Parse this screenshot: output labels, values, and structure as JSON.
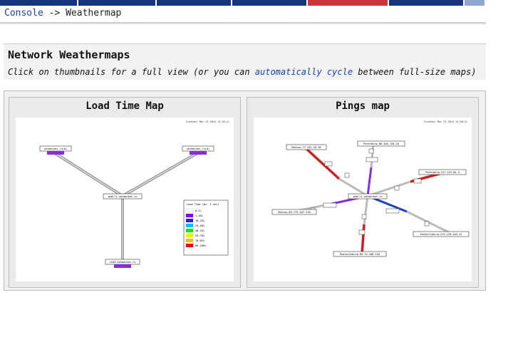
{
  "breadcrumb": {
    "console": "Console",
    "sep": " -> ",
    "current": "Weathermap"
  },
  "section": {
    "title": "Network Weathermaps",
    "sub_before": "Click on thumbnails for a full view (or you can ",
    "sub_link": "automatically cycle",
    "sub_after": " between full-size maps)"
  },
  "maps": [
    {
      "title": "Load Time Map",
      "created": "Created: Mar 23 2014 13:30:21",
      "nodes": [
        "setmarket_ru(0)",
        "setmarket_ru(0)",
        "small1.setmarket.ru",
        "crm3.setmarket.ru"
      ],
      "legend": {
        "title": "Load Time (ms. 1 sec)",
        "items": [
          "0-1%",
          "1-10%",
          "10-25%",
          "25-40%",
          "40-55%",
          "55-70%",
          "70-85%",
          "85-100%"
        ]
      }
    },
    {
      "title": "Pings map",
      "created": "Created: Mar 23 2014 13:30:21",
      "nodes": [
        "Moscow-77.232.20.18",
        "Peterburg-88.205.128.20",
        "Peterburg-217.119.84.4",
        "small1.setmarket.ru",
        "Moscow-89.175.187.218",
        "Ekaterinburg-213.129.240.13",
        "Ekaterinburg-85.12.206.144"
      ]
    }
  ],
  "colors": {
    "topbar": "#15347a",
    "topbar_active": "#c8363b",
    "link": "#1b3fb3"
  }
}
